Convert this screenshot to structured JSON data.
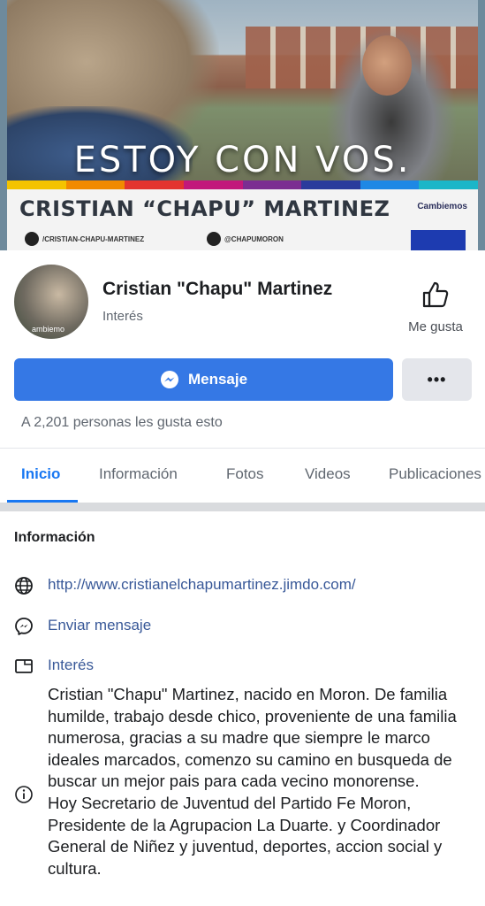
{
  "cover": {
    "slogan": "ESTOY CON VOS.",
    "banner_name": "CRISTIAN “CHAPU” MARTINEZ",
    "brand": "Cambiemos",
    "social_facebook": "/CRISTIAN-CHAPU-MARTINEZ",
    "social_twitter": "@CHAPUMORON",
    "stripe_colors": [
      "#f4c300",
      "#f18a00",
      "#e3342f",
      "#c2187b",
      "#7b2d91",
      "#2a3b9c",
      "#1e88e5",
      "#1bb6c8"
    ]
  },
  "profile": {
    "avatar_text": "ambiemo",
    "name": "Cristian \"Chapu\" Martinez",
    "category": "Interés",
    "like_label": "Me gusta"
  },
  "actions": {
    "message_label": "Mensaje",
    "more_label": "•••"
  },
  "likes_text": "A 2,201 personas les gusta esto",
  "tabs": [
    "Inicio",
    "Información",
    "Fotos",
    "Videos",
    "Publicaciones"
  ],
  "info": {
    "heading": "Información",
    "website": "http://www.cristianelchapumartinez.jimdo.com/",
    "send_message": "Enviar mensaje",
    "category": "Interés",
    "about": "Cristian \"Chapu\" Martinez, nacido en Moron. De familia humilde, trabajo desde chico, proveniente de una familia numerosa, gracias a su madre que siempre le marco ideales marcados, comenzo su camino en busqueda de buscar un mejor pais para cada vecino monorense.\nHoy Secretario de Juventud del Partido Fe Moron, Presidente de la Agrupacion La Duarte. y Coordinador General de Niñez y juventud, deportes, accion social y cultura."
  },
  "colors": {
    "accent": "#1877f2",
    "button": "#3578e5",
    "link": "#385898"
  }
}
